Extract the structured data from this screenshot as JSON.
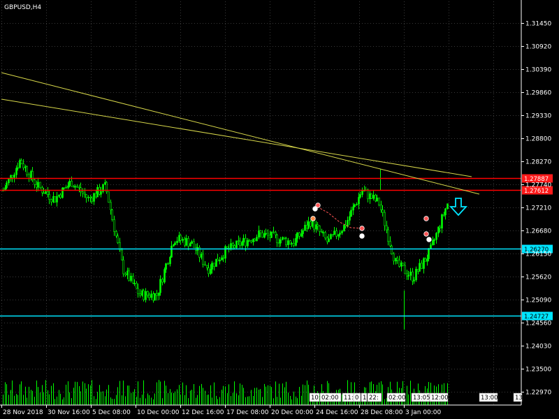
{
  "window": {
    "symbol_label": "GBPUSD,H4"
  },
  "colors": {
    "background": "#000000",
    "grid": "#3a3a3a",
    "candles": "#00ff00",
    "volume": "#00ff00",
    "trendlines": "#d8d84a",
    "resistance_lines": "#ff0000",
    "support_lines": "#00e5ff",
    "arrow_down": "#00e5ff",
    "resistance_label_bg": "#ff1a1a",
    "support_label_bg": "#00e5ff"
  },
  "chart_data": {
    "type": "candlestick",
    "symbol": "GBPUSD",
    "timeframe": "H4",
    "grid": true,
    "y_axis": {
      "side": "right",
      "ticks": [
        "1.31450",
        "1.30920",
        "1.30390",
        "1.29860",
        "1.29330",
        "1.28800",
        "1.28270",
        "1.27740",
        "1.27210",
        "1.26680",
        "1.26150",
        "1.25620",
        "1.25090",
        "1.24560",
        "1.24030",
        "1.23500",
        "1.22970"
      ]
    },
    "x_axis": {
      "ticks": [
        "28 Nov 2018",
        "30 Nov 16:00",
        "5 Dec 08:00",
        "10 Dec 00:00",
        "12 Dec 16:00",
        "17 Dec 08:00",
        "20 Dec 00:00",
        "24 Dec 16:00",
        "28 Dec 08:00",
        "3 Jan 00:00"
      ]
    },
    "horizontal_levels": [
      {
        "value": 1.27887,
        "label": "1.27887",
        "kind": "resistance"
      },
      {
        "value": 1.27612,
        "label": "1.27612",
        "kind": "resistance"
      },
      {
        "value": 1.2627,
        "label": "1.26270",
        "kind": "support"
      },
      {
        "value": 1.24727,
        "label": "1.24727",
        "kind": "support"
      }
    ],
    "trendlines": [
      {
        "from": [
          "28 Nov 2018",
          1.2963
        ],
        "to": [
          "3 Jan 00:00",
          1.2794
        ]
      },
      {
        "from": [
          "28 Nov 2018",
          1.3025
        ],
        "to": [
          "3 Jan 00:00",
          1.2763
        ]
      }
    ],
    "price_path": [
      [
        "28 Nov 2018",
        1.276
      ],
      [
        "29 Nov",
        1.283
      ],
      [
        "30 Nov 16:00",
        1.277
      ],
      [
        "3 Dec",
        1.274
      ],
      [
        "5 Dec 08:00",
        1.278
      ],
      [
        "6 Dec",
        1.274
      ],
      [
        "7 Dec",
        1.277
      ],
      [
        "10 Dec 00:00",
        1.258
      ],
      [
        "11 Dec",
        1.252
      ],
      [
        "12 Dec",
        1.252
      ],
      [
        "12 Dec 16:00",
        1.265
      ],
      [
        "13 Dec",
        1.264
      ],
      [
        "14 Dec",
        1.258
      ],
      [
        "17 Dec 08:00",
        1.262
      ],
      [
        "18 Dec",
        1.264
      ],
      [
        "19 Dec",
        1.266
      ],
      [
        "20 Dec 00:00",
        1.265
      ],
      [
        "21 Dec",
        1.264
      ],
      [
        "24 Dec 16:00",
        1.269
      ],
      [
        "26 Dec",
        1.264
      ],
      [
        "27 Dec",
        1.268
      ],
      [
        "28 Dec 08:00",
        1.276
      ],
      [
        "31 Dec",
        1.273
      ],
      [
        "2 Jan",
        1.259
      ],
      [
        "2 Jan b",
        1.256
      ],
      [
        "3 Jan 00:00",
        1.262
      ],
      [
        "4 Jan",
        1.273
      ]
    ],
    "signal_arrow": {
      "direction": "down"
    },
    "time_tags": [
      "10:",
      "02:00",
      "11:",
      "0",
      "1",
      "22:",
      "02:00",
      "13:05",
      "12:00",
      "13:00",
      "13:"
    ]
  }
}
